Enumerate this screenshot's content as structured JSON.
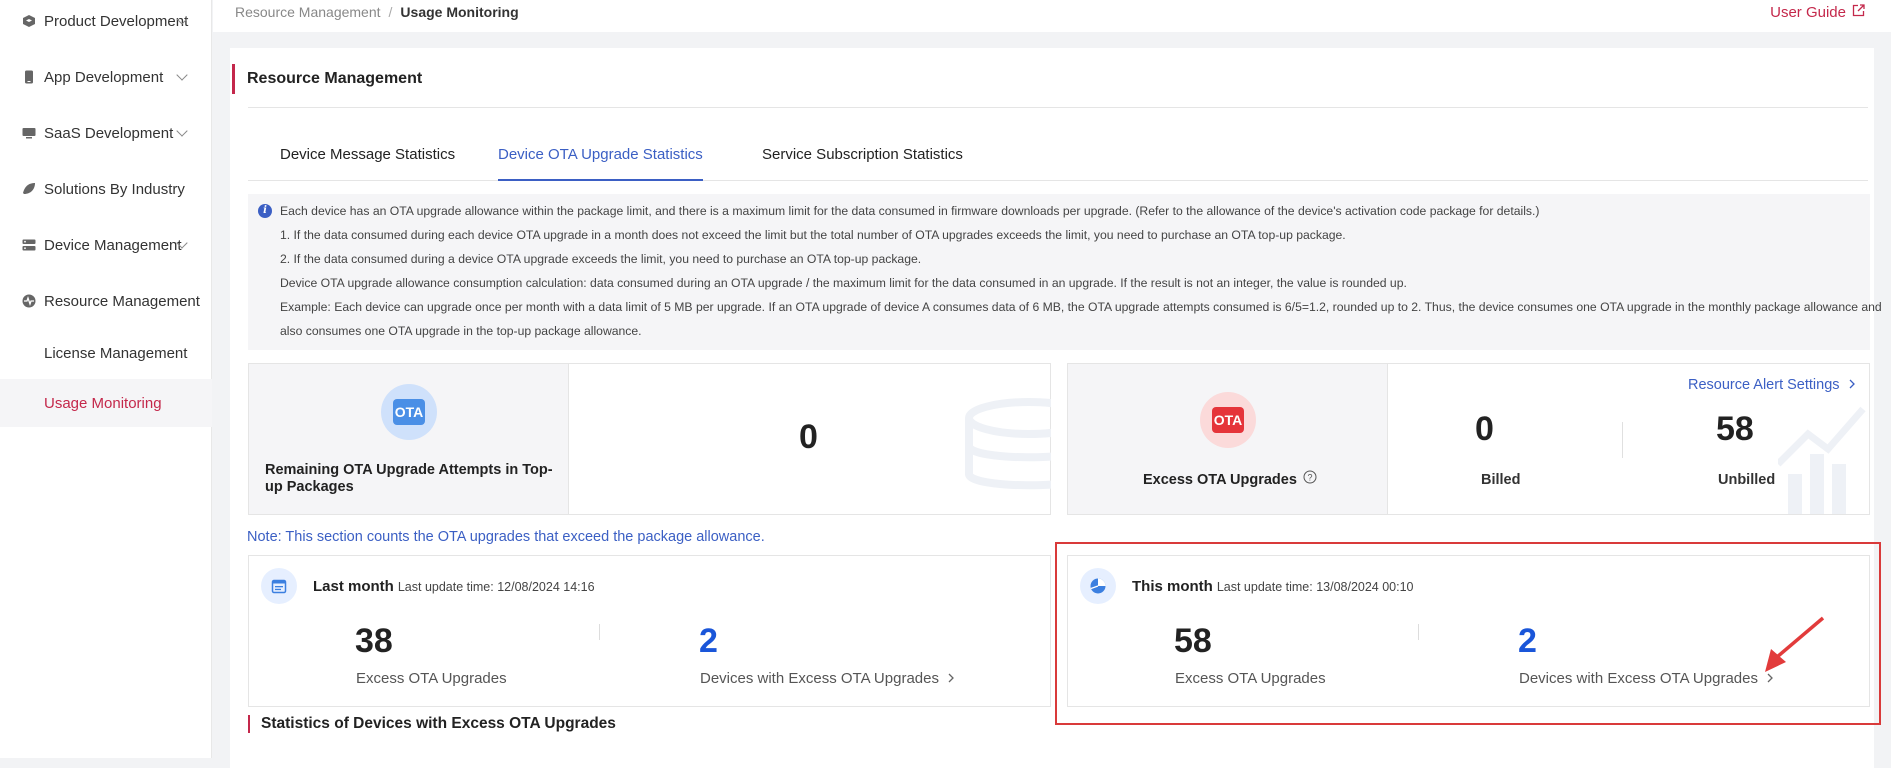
{
  "sidebar": {
    "items": [
      {
        "label": "Product Development"
      },
      {
        "label": "App Development"
      },
      {
        "label": "SaaS Development"
      },
      {
        "label": "Solutions By Industry"
      },
      {
        "label": "Device Management"
      },
      {
        "label": "Resource Management"
      }
    ],
    "sub_items": [
      {
        "label": "License Management"
      },
      {
        "label": "Usage Monitoring"
      }
    ]
  },
  "topbar": {
    "crumb_parent": "Resource Management",
    "crumb_sep": "/",
    "crumb_current": "Usage Monitoring",
    "user_guide": "User Guide"
  },
  "main": {
    "title": "Resource Management",
    "tabs": [
      {
        "label": "Device Message Statistics"
      },
      {
        "label": "Device OTA Upgrade Statistics"
      },
      {
        "label": "Service Subscription Statistics"
      }
    ],
    "notice": [
      "Each device has an OTA upgrade allowance within the package limit, and there is a maximum limit for the data consumed in firmware downloads per upgrade. (Refer to the allowance of the device's activation code package for details.)",
      "1. If the data consumed during each device OTA upgrade in a month does not exceed the limit but the total number of OTA upgrades exceeds the limit, you need to purchase an OTA top-up package.",
      "2. If the data consumed during a device OTA upgrade exceeds the limit, you need to purchase an OTA top-up package.",
      "Device OTA upgrade allowance consumption calculation: data consumed during an OTA upgrade / the maximum limit for the data consumed in an upgrade. If the result is not an integer, the value is rounded up.",
      "Example: Each device can upgrade once per month with a data limit of 5 MB per upgrade. If an OTA upgrade of device A consumes data of 6 MB, the OTA upgrade attempts consumed is 6/5=1.2, rounded up to 2. Thus, the device consumes one OTA upgrade in the monthly package allowance and",
      "also consumes one OTA upgrade in the top-up package allowance."
    ],
    "remaining": {
      "badge": "OTA",
      "label": "Remaining OTA Upgrade Attempts in Top-up Packages",
      "value": "0"
    },
    "excess": {
      "badge": "OTA",
      "label": "Excess OTA Upgrades",
      "alert_link": "Resource Alert Settings",
      "billed_value": "0",
      "billed_label": "Billed",
      "unbilled_value": "58",
      "unbilled_label": "Unbilled"
    },
    "note": "Note: This section counts the OTA upgrades that exceed the package allowance.",
    "last_month": {
      "title": "Last month",
      "update": "Last update time: 12/08/2024 14:16",
      "excess_value": "38",
      "excess_label": "Excess OTA Upgrades",
      "devices_value": "2",
      "devices_label": "Devices with Excess OTA Upgrades"
    },
    "this_month": {
      "title": "This month",
      "update": "Last update time: 13/08/2024 00:10",
      "excess_value": "58",
      "excess_label": "Excess OTA Upgrades",
      "devices_value": "2",
      "devices_label": "Devices with Excess OTA Upgrades"
    },
    "stats_title": "Statistics of Devices with Excess OTA Upgrades"
  },
  "colors": {
    "accent": "#c4284b",
    "link_blue": "#3b5fc4",
    "number_blue": "#1a56d9",
    "highlight_red": "#d93a3a"
  }
}
